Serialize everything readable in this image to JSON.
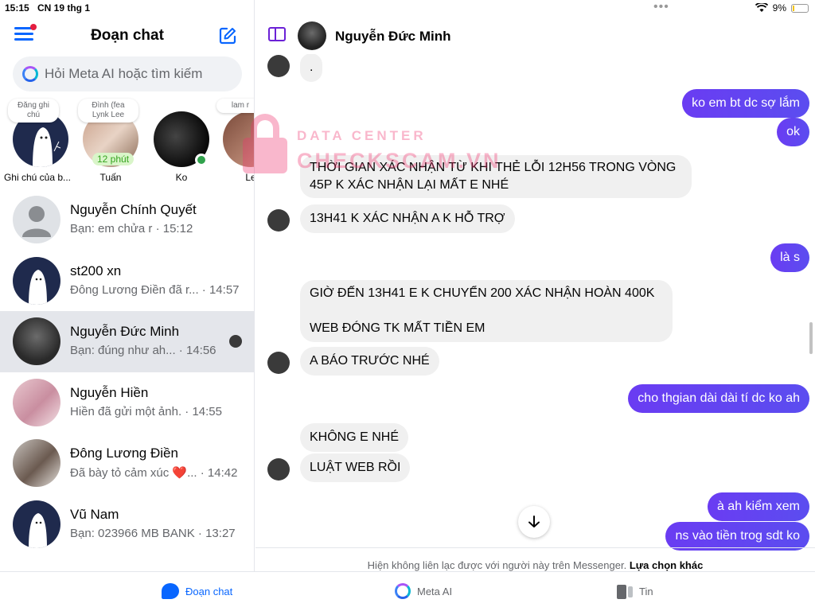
{
  "status": {
    "time": "15:15",
    "date": "CN 19 thg 1",
    "battery": "9%"
  },
  "left": {
    "title": "Đoạn chat",
    "search_placeholder": "Hỏi Meta AI hoặc tìm kiếm",
    "stories": [
      {
        "note": "Đăng ghi chú",
        "name": "Ghi chú của b..."
      },
      {
        "note": "Đình (fea",
        "note2": "Lynk Lee",
        "name": "Tuấn",
        "ago": "12 phút"
      },
      {
        "name": "Ko"
      },
      {
        "note": "lam r",
        "name": "Le"
      }
    ],
    "conversations": [
      {
        "name": "Nguyễn Chính Quyết",
        "preview": "Bạn: em chửa r · 15:12"
      },
      {
        "name": "st200 xn",
        "preview": "Đông Lương Điền đã r... · 14:57"
      },
      {
        "name": "Nguyễn Đức Minh",
        "preview": "Bạn: đúng như ah... · 14:56"
      },
      {
        "name": "Nguyễn Hiền",
        "preview": "Hiền đã gửi một ảnh. · 14:55"
      },
      {
        "name": "Đông Lương Điền",
        "preview": "Đã bày tỏ cảm xúc ❤️... · 14:42"
      },
      {
        "name": "Vũ Nam",
        "preview": "Bạn: 023966 MB BANK · 13:27"
      }
    ]
  },
  "chat": {
    "contact": "Nguyễn Đức Minh",
    "messages": [
      {
        "dir": "in",
        "text": "."
      },
      {
        "dir": "out",
        "text": "ko em bt dc sợ lắm"
      },
      {
        "dir": "out",
        "text": "ok"
      },
      {
        "dir": "in",
        "text": "THỜI GIAN XÁC NHẬN TỪ KHI THẺ LỖI 12H56 TRONG VÒNG"
      },
      {
        "dir": "in",
        "text": "45P K XÁC NHẬN LẠI MẤT E NHÉ"
      },
      {
        "dir": "in",
        "text": "13H41 K XÁC NHẬN A K HỖ TRỢ"
      },
      {
        "dir": "out",
        "text": "là s"
      },
      {
        "dir": "in",
        "text": "GIỜ ĐẾN 13H41 E K CHUYỂN 200 XÁC NHẬN HOÀN 400K"
      },
      {
        "dir": "in",
        "text": "WEB ĐÓNG TK MẤT TIỀN EM"
      },
      {
        "dir": "in",
        "text": "A BÁO TRƯỚC NHÉ"
      },
      {
        "dir": "out",
        "text": "cho thgian dài dài tí dc ko ah"
      },
      {
        "dir": "in",
        "text": "KHÔNG E NHÉ"
      },
      {
        "dir": "in",
        "text": "LUẬT WEB RỒI"
      },
      {
        "dir": "out",
        "text": "à ah kiểm xem"
      },
      {
        "dir": "out",
        "text": "ns vào tiền trog sdt ko"
      }
    ],
    "notice": "Hiện không liên lạc được với người này trên Messenger.",
    "notice_action": "Lựa chọn khác"
  },
  "tabs": {
    "chats": "Đoạn chat",
    "meta_ai": "Meta AI",
    "stories": "Tin"
  },
  "watermark": {
    "line1": "DATA CENTER",
    "line2": "CHECKSCAM.VN"
  },
  "colors": {
    "accent": "#0866ff",
    "outgoing": "#6a3cf2",
    "incoming": "#f0f0f0",
    "watermark": "#f0356e"
  }
}
